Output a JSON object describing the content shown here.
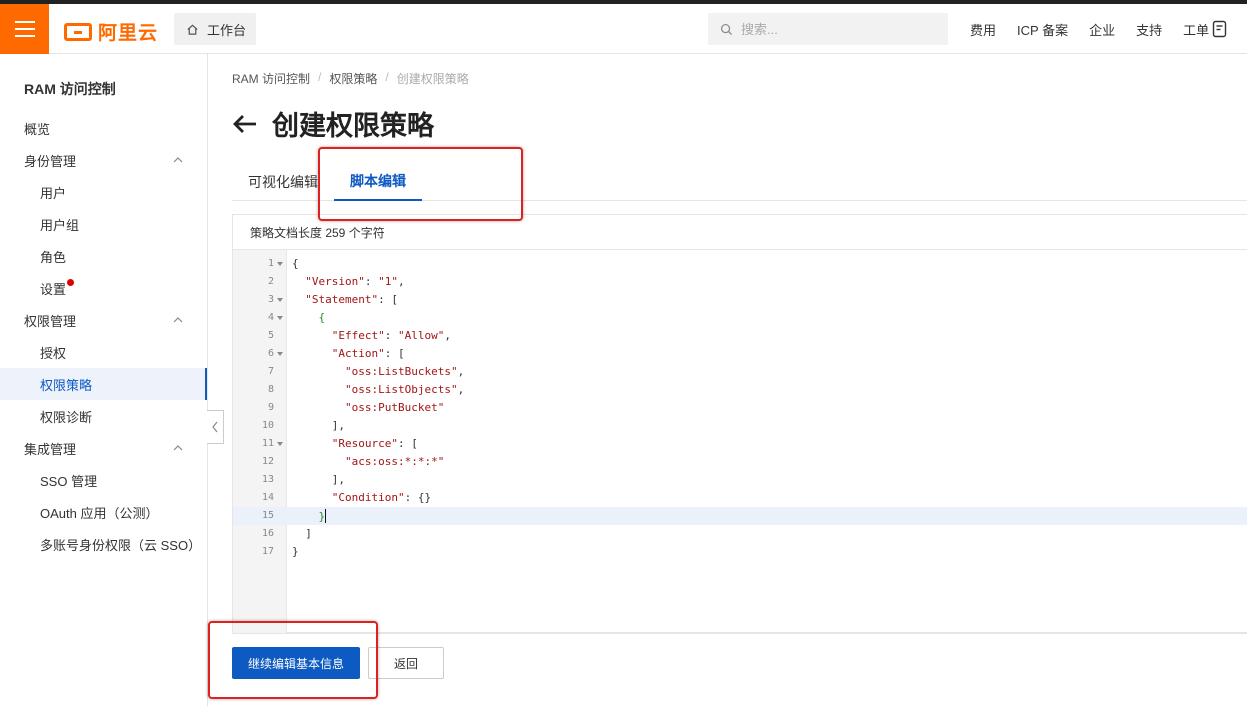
{
  "header": {
    "logo_text": "阿里云",
    "workbench_label": "工作台",
    "search_placeholder": "搜索...",
    "nav": [
      "费用",
      "ICP 备案",
      "企业",
      "支持",
      "工单"
    ],
    "accent_color": "#ff6a00"
  },
  "sidebar": {
    "title": "RAM 访问控制",
    "items": [
      {
        "label": "概览"
      },
      {
        "label": "身份管理"
      },
      {
        "label": "用户"
      },
      {
        "label": "用户组"
      },
      {
        "label": "角色"
      },
      {
        "label": "设置"
      },
      {
        "label": "权限管理"
      },
      {
        "label": "授权"
      },
      {
        "label": "权限策略"
      },
      {
        "label": "权限诊断"
      },
      {
        "label": "集成管理"
      },
      {
        "label": "SSO 管理"
      },
      {
        "label": "OAuth 应用（公测）"
      },
      {
        "label": "多账号身份权限（云 SSO）"
      }
    ],
    "active_item": "权限策略"
  },
  "main": {
    "breadcrumb": [
      "RAM 访问控制",
      "权限策略",
      "创建权限策略"
    ],
    "title": "创建权限策略",
    "tabs": [
      {
        "label": "可视化编辑"
      },
      {
        "label": "脚本编辑",
        "active": true
      }
    ],
    "policy_length_text": "策略文档长度 259 个字符",
    "code_lines": [
      "{",
      "  \"Version\": \"1\",",
      "  \"Statement\": [",
      "    {",
      "      \"Effect\": \"Allow\",",
      "      \"Action\": [",
      "        \"oss:ListBuckets\",",
      "        \"oss:ListObjects\",",
      "        \"oss:PutBucket\"",
      "      ],",
      "      \"Resource\": [",
      "        \"acs:oss:*:*:*\"",
      "      ],",
      "      \"Condition\": {}",
      "    }",
      "  ]",
      "}"
    ],
    "line_numbers": [
      "1",
      "2",
      "3",
      "4",
      "5",
      "6",
      "7",
      "8",
      "9",
      "10",
      "11",
      "12",
      "13",
      "14",
      "15",
      "16",
      "17"
    ],
    "foldable_lines": [
      1,
      3,
      4,
      6,
      11
    ],
    "highlighted_line": 15,
    "buttons": {
      "continue": "继续编辑基本信息",
      "back": "返回"
    },
    "primary_color": "#0d5ac2"
  }
}
